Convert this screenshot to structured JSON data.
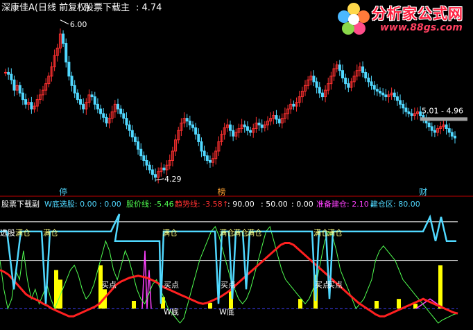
{
  "main_title": {
    "name": "深康佳A(日线 前复权)",
    "indicator": "股票下载主",
    "value": ": 4.74"
  },
  "sub_title": {
    "name": "股票下载副",
    "items": [
      {
        "text": "W底选股: 0.00 : 0.00",
        "color": "#50d8ff"
      },
      {
        "text": "股价线: -5.46",
        "color": "#50ff50",
        "arrow": "↑",
        "arrow_color": "#ff3030"
      },
      {
        "text": "趋势线: -3.58",
        "color": "#ff3030",
        "arrow": "↑",
        "arrow_color": "#ff3030"
      },
      {
        "text": ": 90.00",
        "color": "#ffffff"
      },
      {
        "text": ": 50.00",
        "color": "#ffffff"
      },
      {
        "text": ": 0.00",
        "color": "#ffffff"
      },
      {
        "text": "准备建仓: 2.10",
        "color": "#ff40ff",
        "arrow": "↓",
        "arrow_color": "#50d8ff"
      },
      {
        "text": "建仓区: 80.00",
        "color": "#50d8ff"
      }
    ]
  },
  "watermark": {
    "title": "分析家公式网",
    "url": "www.88gs.com"
  },
  "annotations": {
    "high": "6.00",
    "low": "4.29",
    "right_range": "5.01 - 4.96"
  },
  "event_markers": [
    {
      "label": "停",
      "color": "#50d8ff",
      "at_bar": 20
    },
    {
      "label": "榜",
      "color": "#ffa030",
      "at_bar": 75
    },
    {
      "label": "财",
      "color": "#50d8ff",
      "at_bar": 145
    }
  ],
  "signals": {
    "full_position": "满仓",
    "buy_point": "买点",
    "w_bottom": "W底",
    "select_stock": "选股"
  },
  "colors": {
    "up": "#ff3030",
    "down": "#50d8ff",
    "divider": "#c00000",
    "price_line": "#50ff50",
    "trend_line": "#ff2020",
    "select_line": "#50d8ff",
    "bars": "#ffff00",
    "magenta": "#ff40ff",
    "dashed": "#4040ff"
  },
  "chart_data": [
    {
      "type": "candlestick",
      "title": "深康佳A(日线 前复权)",
      "ylim": [
        4.2,
        6.05
      ],
      "annotated_values": {
        "max": 6.0,
        "min": 4.29,
        "last": 4.74,
        "level_range": [
          4.96,
          5.01
        ]
      },
      "close": [
        5.44,
        5.42,
        5.36,
        5.25,
        5.3,
        5.22,
        5.15,
        5.1,
        5.12,
        5.05,
        5.08,
        5.15,
        5.2,
        5.25,
        5.32,
        5.4,
        5.5,
        5.62,
        5.7,
        5.85,
        5.75,
        5.55,
        5.4,
        5.3,
        5.22,
        5.15,
        5.1,
        5.05,
        5.12,
        5.2,
        5.18,
        5.1,
        5.05,
        5.0,
        4.96,
        4.9,
        4.95,
        5.02,
        5.1,
        5.05,
        5.0,
        4.95,
        4.88,
        4.82,
        4.75,
        4.7,
        4.62,
        4.55,
        4.5,
        4.45,
        4.4,
        4.35,
        4.32,
        4.38,
        4.42,
        4.4,
        4.45,
        4.5,
        4.6,
        4.72,
        4.82,
        4.9,
        4.95,
        4.92,
        4.88,
        4.85,
        4.78,
        4.7,
        4.6,
        4.55,
        4.5,
        4.48,
        4.52,
        4.6,
        4.7,
        4.78,
        4.85,
        4.88,
        4.82,
        4.76,
        4.8,
        4.84,
        4.88,
        4.86,
        4.82,
        4.8,
        4.84,
        4.9,
        4.88,
        4.85,
        4.88,
        4.92,
        4.95,
        4.98,
        4.94,
        4.9,
        4.95,
        5.0,
        5.05,
        5.1,
        5.08,
        5.12,
        5.18,
        5.24,
        5.3,
        5.36,
        5.4,
        5.34,
        5.28,
        5.22,
        5.18,
        5.25,
        5.32,
        5.4,
        5.48,
        5.52,
        5.46,
        5.38,
        5.32,
        5.28,
        5.34,
        5.4,
        5.46,
        5.5,
        5.44,
        5.38,
        5.34,
        5.3,
        5.26,
        5.24,
        5.22,
        5.2,
        5.18,
        5.2,
        5.22,
        5.18,
        5.14,
        5.1,
        5.06,
        5.02,
        5.0,
        4.98,
        5.0,
        5.02,
        4.98,
        4.94,
        4.9,
        4.86,
        4.82,
        4.8,
        4.84,
        4.86,
        4.88,
        4.84,
        4.8,
        4.76,
        4.74
      ]
    },
    {
      "type": "line",
      "title": "股票下载副",
      "ylim": [
        -15,
        100
      ],
      "reference_lines": [
        90,
        50,
        0
      ],
      "series": [
        {
          "name": "股价线",
          "values": [
            50,
            20,
            0,
            10,
            40,
            30,
            60,
            30,
            10,
            20,
            5,
            15,
            25,
            10,
            0,
            10,
            20,
            30,
            40,
            45,
            35,
            20,
            10,
            15,
            25,
            40,
            55,
            70,
            60,
            40,
            30,
            45,
            60,
            50,
            35,
            20,
            10,
            5,
            15,
            25,
            30,
            20,
            10,
            0,
            -5,
            -10,
            -15,
            -10,
            5,
            20,
            35,
            50,
            60,
            70,
            80,
            85,
            75,
            60,
            45,
            30,
            20,
            10,
            5,
            10,
            20,
            35,
            50,
            65,
            80,
            85,
            70,
            55,
            40,
            30,
            25,
            20,
            15,
            10,
            5,
            10,
            20,
            30,
            50,
            70,
            80,
            75,
            60,
            40,
            30,
            20,
            10,
            0,
            5,
            10,
            20,
            30,
            50,
            60,
            65,
            60,
            55,
            50,
            40,
            30,
            25,
            20,
            15,
            10,
            5,
            0,
            -5,
            -10,
            -15,
            -12,
            -10,
            -8,
            -6,
            -5
          ]
        },
        {
          "name": "趋势线",
          "values": [
            40,
            38,
            35,
            30,
            25,
            20,
            15,
            12,
            10,
            8,
            5,
            3,
            0,
            -2,
            -4,
            -6,
            -8,
            -8,
            -6,
            -4,
            -2,
            0,
            2,
            5,
            10,
            15,
            20,
            25,
            28,
            30,
            32,
            33,
            34,
            33,
            32,
            30,
            28,
            25,
            22,
            20,
            18,
            16,
            14,
            12,
            10,
            8,
            6,
            5,
            6,
            8,
            10,
            12,
            15,
            18,
            22,
            26,
            30,
            34,
            38,
            42,
            46,
            50,
            54,
            58,
            62,
            66,
            68,
            68,
            66,
            62,
            58,
            54,
            50,
            46,
            42,
            38,
            34,
            30,
            26,
            22,
            18,
            14,
            10,
            6,
            3,
            0,
            -3,
            -6,
            -8,
            -8,
            -6,
            -4,
            -2,
            0,
            2,
            4,
            6,
            8,
            10,
            8,
            6,
            4,
            2,
            0,
            -2,
            -4,
            -5
          ]
        }
      ]
    }
  ]
}
